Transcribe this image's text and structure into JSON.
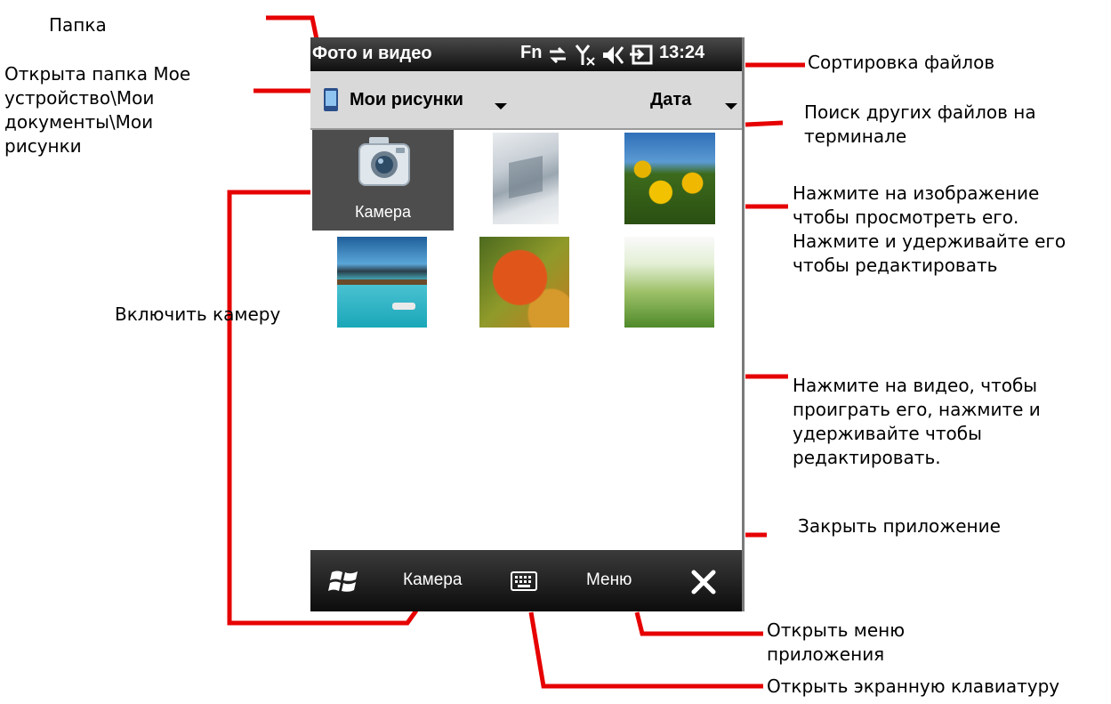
{
  "annotations": {
    "folder": "Папка",
    "open_folder": [
      "Открыта папка Мое",
      "устройство\\Мои",
      "документы\\Мои",
      "рисунки"
    ],
    "enable_camera": "Включить камеру",
    "sort_files": "Сортировка файлов",
    "search_files": [
      "Поиск других файлов на",
      "терминале"
    ],
    "tap_image": [
      "Нажмите на изображение",
      "чтобы просмотреть его.",
      "Нажмите и удерживайте его",
      "чтобы редактировать"
    ],
    "tap_video": [
      "Нажмите на видео, чтобы",
      "проиграть его, нажмите и",
      "удерживайте чтобы",
      "редактировать."
    ],
    "close_app": "Закрыть приложение",
    "open_menu": [
      "Открыть меню",
      "приложения"
    ],
    "open_keyboard": "Открыть экранную клавиатуру"
  },
  "status_bar": {
    "app_title": "Фото и видео",
    "fn_label": "Fn",
    "time": "13:24",
    "icons": [
      "data-sync-icon",
      "no-signal-icon",
      "volume-muted-icon",
      "power-icon"
    ]
  },
  "folder_bar": {
    "folder_name": "Мои рисунки",
    "sort_label": "Дата"
  },
  "gallery": {
    "camera_tile_label": "Камера",
    "thumbnails": [
      "thumb-window",
      "thumb-yellow-flowers",
      "thumb-tropical-pier",
      "thumb-autumn-leaf",
      "thumb-grass"
    ]
  },
  "soft_keys": {
    "left": "Камера",
    "right": "Меню",
    "start_icon": "windows-start-icon",
    "keyboard_icon": "keyboard-icon",
    "close_icon": "close-icon"
  },
  "colors": {
    "callout_line": "#e00000",
    "status_bar": "#1a1a1a",
    "folder_bar": "#d9d9d9",
    "camera_tile": "#4d4d4d"
  }
}
